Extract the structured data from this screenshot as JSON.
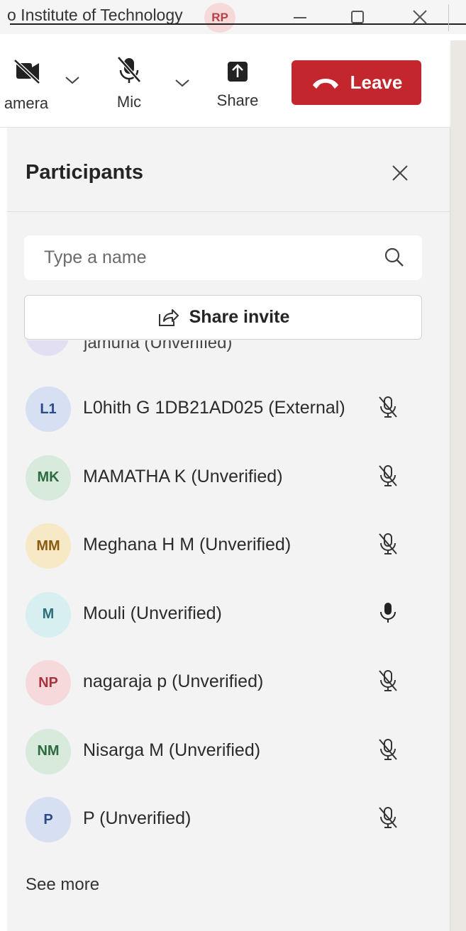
{
  "titlebar": {
    "org": "o Institute of Technology",
    "avatar_initials": "RP"
  },
  "toolbar": {
    "camera_label": "amera",
    "mic_label": "Mic",
    "share_label": "Share",
    "leave_label": "Leave"
  },
  "panel": {
    "title": "Participants",
    "search_placeholder": "Type a name",
    "share_invite": "Share invite",
    "partial_name": "jamuna (Unverified)",
    "see_more": "See more"
  },
  "participants": [
    {
      "initials": "L1",
      "name": "L0hith G 1DB21AD025 (External)",
      "muted": true,
      "avatar_bg": "#d7dff2",
      "avatar_fg": "#2b4a8a"
    },
    {
      "initials": "MK",
      "name": "MAMATHA K (Unverified)",
      "muted": true,
      "avatar_bg": "#d7eadc",
      "avatar_fg": "#2d6a3e"
    },
    {
      "initials": "MM",
      "name": "Meghana H M (Unverified)",
      "muted": true,
      "avatar_bg": "#f7e8c6",
      "avatar_fg": "#8a5a10"
    },
    {
      "initials": "M",
      "name": "Mouli (Unverified)",
      "muted": false,
      "avatar_bg": "#d8eff2",
      "avatar_fg": "#2d6f78"
    },
    {
      "initials": "NP",
      "name": "nagaraja p (Unverified)",
      "muted": true,
      "avatar_bg": "#f6dadb",
      "avatar_fg": "#a8333e"
    },
    {
      "initials": "NM",
      "name": "Nisarga M (Unverified)",
      "muted": true,
      "avatar_bg": "#d7eadc",
      "avatar_fg": "#2d6a3e"
    },
    {
      "initials": "P",
      "name": "P (Unverified)",
      "muted": true,
      "avatar_bg": "#d7dff2",
      "avatar_fg": "#2b4a8a"
    }
  ],
  "colors": {
    "leave": "#c4262e",
    "panel_bg": "#f3f3f3"
  }
}
